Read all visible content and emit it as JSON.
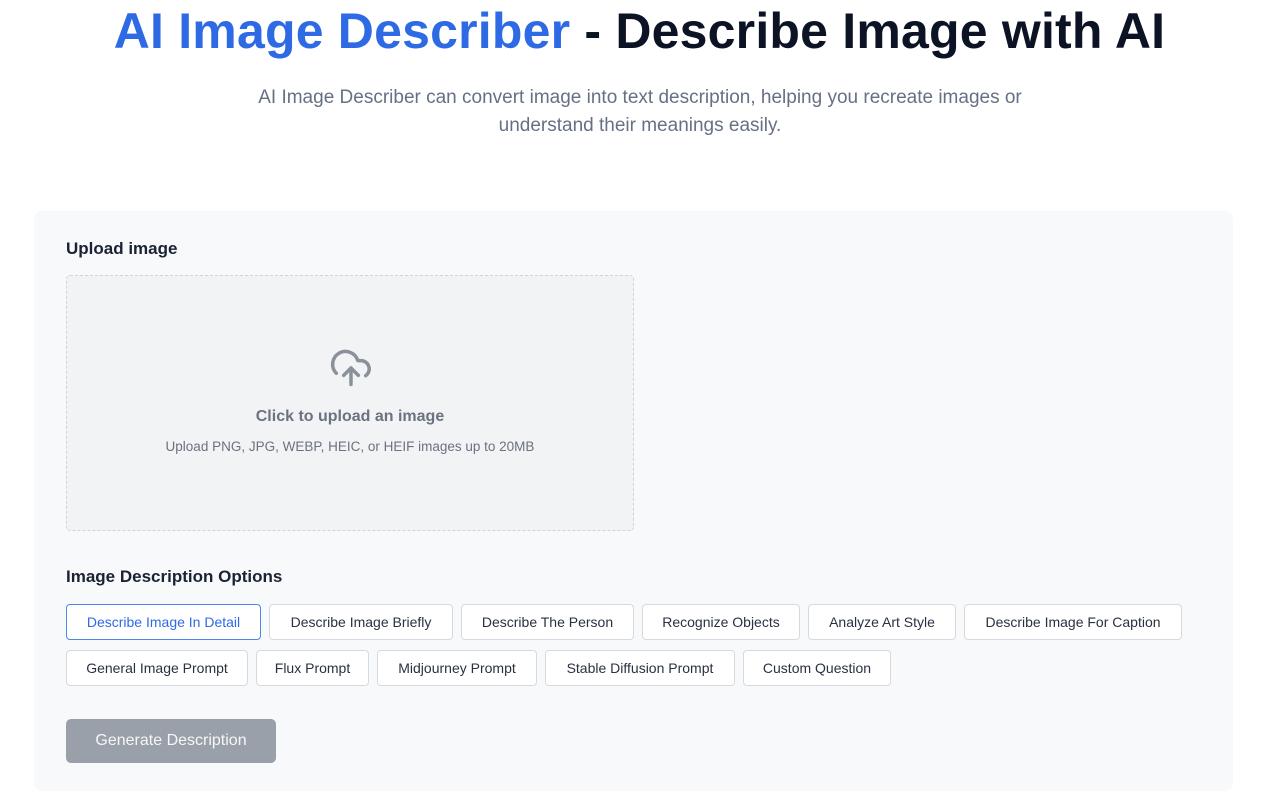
{
  "hero": {
    "title_accent": "AI Image Describer",
    "title_rest": " - Describe Image with AI",
    "subtitle": "AI Image Describer can convert image into text description, helping you recreate images or understand their meanings easily."
  },
  "upload": {
    "label": "Upload image",
    "icon": "cloud-upload-icon",
    "title": "Click to upload an image",
    "hint": "Upload PNG, JPG, WEBP, HEIC, or HEIF images up to 20MB"
  },
  "options": {
    "label": "Image Description Options",
    "items": [
      {
        "label": "Describe Image In Detail",
        "selected": true
      },
      {
        "label": "Describe Image Briefly",
        "selected": false
      },
      {
        "label": "Describe The Person",
        "selected": false
      },
      {
        "label": "Recognize Objects",
        "selected": false
      },
      {
        "label": "Analyze Art Style",
        "selected": false
      },
      {
        "label": "Describe Image For Caption",
        "selected": false
      },
      {
        "label": "General Image Prompt",
        "selected": false
      },
      {
        "label": "Flux Prompt",
        "selected": false
      },
      {
        "label": "Midjourney Prompt",
        "selected": false
      },
      {
        "label": "Stable Diffusion Prompt",
        "selected": false
      },
      {
        "label": "Custom Question",
        "selected": false
      }
    ]
  },
  "actions": {
    "generate_label": "Generate Description"
  },
  "colors": {
    "accent": "#2f6ae5",
    "title": "#0b1324",
    "muted": "#667085",
    "button_disabled": "#9aa0aa"
  }
}
